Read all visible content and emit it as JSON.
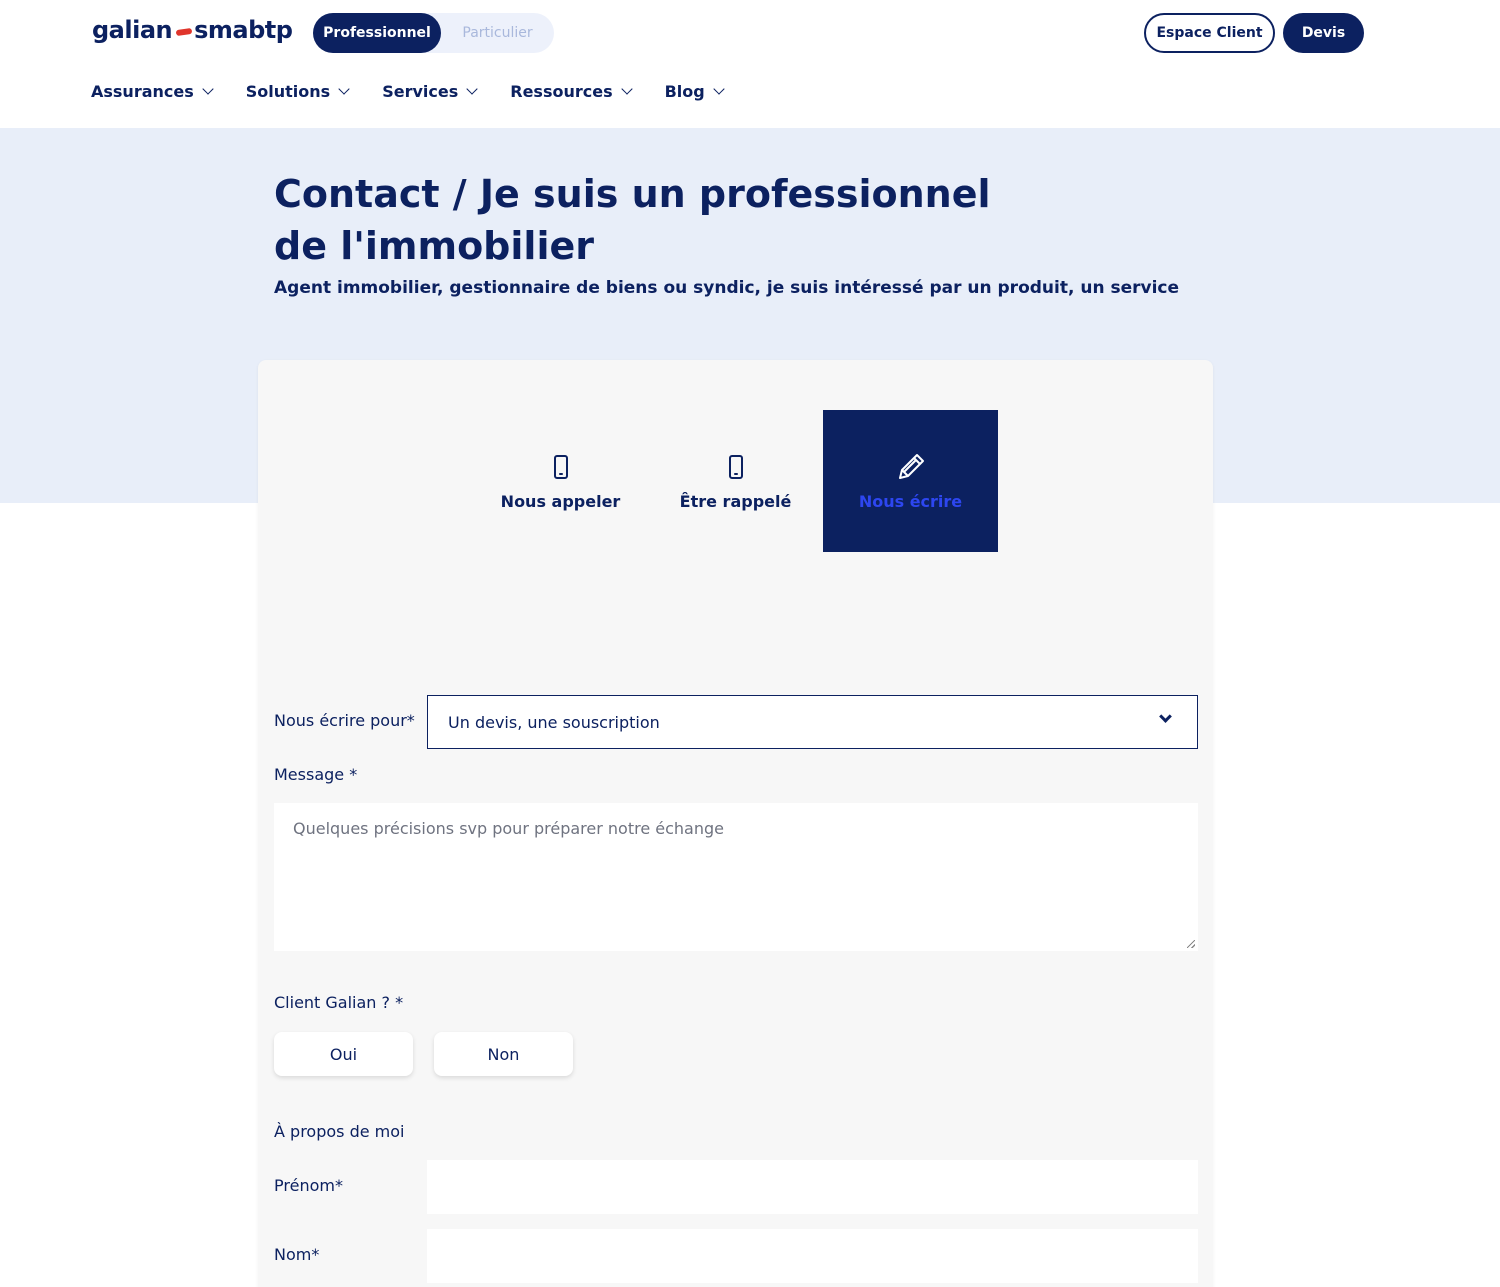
{
  "header": {
    "logo_left": "galian",
    "logo_right": "smabtp",
    "segment": {
      "pro_label": "Professionnel",
      "part_label": "Particulier"
    },
    "espace_label": "Espace Client",
    "devis_label": "Devis",
    "nav": [
      "Assurances",
      "Solutions",
      "Services",
      "Ressources",
      "Blog"
    ]
  },
  "hero": {
    "title": "Contact / Je suis un professionnel de l'immobilier",
    "subtitle": "Agent immobilier, gestionnaire de biens ou syndic, je suis intéressé par un produit, un service"
  },
  "tabs": {
    "call": "Nous appeler",
    "callback": "Être rappelé",
    "write": "Nous écrire"
  },
  "form": {
    "purpose_label": "Nous écrire pour*",
    "purpose_value": "Un devis, une souscription",
    "message_label": "Message *",
    "message_placeholder": "Quelques précisions svp pour préparer notre échange",
    "client_label": "Client Galian ? *",
    "yes": "Oui",
    "no": "Non",
    "about_label": "À propos de moi",
    "firstname_label": "Prénom*",
    "lastname_label": "Nom*"
  },
  "colors": {
    "navy": "#0c2160",
    "accent_red": "#e0352b",
    "hero_bg": "#e8eef9",
    "active_tab_text": "#2d46f0"
  }
}
